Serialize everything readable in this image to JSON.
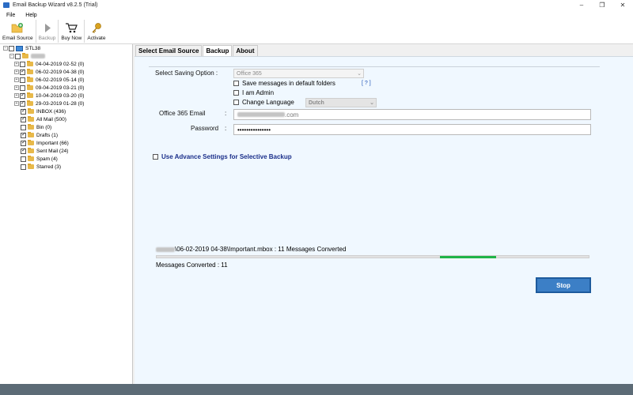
{
  "window": {
    "title": "Email Backup Wizard v8.2.5 (Trial)",
    "controls": [
      "–",
      "❐",
      "✕"
    ]
  },
  "menu": {
    "file": "File",
    "help": "Help"
  },
  "toolbar": {
    "email_source": "Email Source",
    "backup": "Backup",
    "buy_now": "Buy Now",
    "activate": "Activate"
  },
  "tree": {
    "root": "STL38",
    "folders": [
      {
        "label": "04-04-2019 02-52 (0)",
        "checked": false
      },
      {
        "label": "06-02-2019 04-38 (0)",
        "checked": true
      },
      {
        "label": "06-02-2019 05-14 (0)",
        "checked": false
      },
      {
        "label": "09-04-2019 03-21 (0)",
        "checked": false
      },
      {
        "label": "10-04-2019 03-20 (0)",
        "checked": true
      },
      {
        "label": "29-03-2019 01-28 (0)",
        "checked": true
      }
    ],
    "mail_folders": [
      {
        "label": "INBOX (436)",
        "checked": true
      },
      {
        "label": "All Mail (500)",
        "checked": true
      },
      {
        "label": "Bin (0)",
        "checked": false
      },
      {
        "label": "Drafts (1)",
        "checked": true
      },
      {
        "label": "Important (66)",
        "checked": true
      },
      {
        "label": "Sent Mail (24)",
        "checked": true
      },
      {
        "label": "Spam (4)",
        "checked": false
      },
      {
        "label": "Starred (3)",
        "checked": false
      }
    ]
  },
  "tabs": {
    "select_source": "Select Email Source",
    "backup": "Backup",
    "about": "About"
  },
  "backup": {
    "saving_option_label": "Select Saving Option :",
    "saving_option_value": "Office 365",
    "save_default_folders": "Save messages in default folders",
    "help": "[ ? ]",
    "i_am_admin": "I am Admin",
    "change_language": "Change Language",
    "language_value": "Dutch",
    "email_label": "Office 365 Email",
    "email_colon": ":",
    "email_suffix": ".com",
    "password_label": "Password",
    "password_colon": ":",
    "password_value": "•••••••••••••••",
    "advance_settings": "Use Advance Settings for Selective Backup",
    "progress_path": "\\06-02-2019 04-38\\Important.mbox : 11 Messages Converted",
    "progress_fraction": 0.13,
    "messages_converted": "Messages Converted : 11",
    "stop": "Stop"
  },
  "colors": {
    "accent": "#3c7fc6",
    "progress": "#1fb448",
    "link": "#1a4fb5"
  }
}
